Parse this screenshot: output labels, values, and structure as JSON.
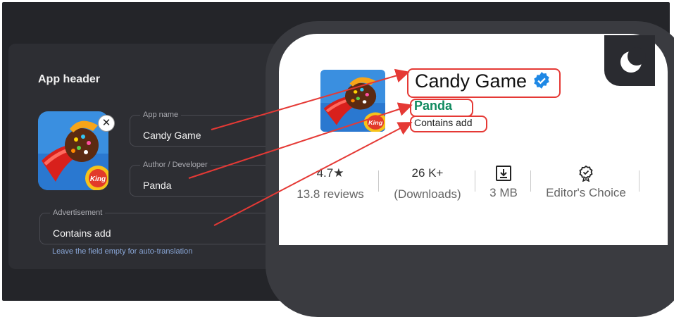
{
  "panel": {
    "title": "App header",
    "app_name_label": "App name",
    "app_name_value": "Candy Game",
    "author_label": "Author / Developer",
    "author_value": "Panda",
    "ad_label": "Advertisement",
    "ad_value": "Contains add",
    "hint": "Leave the field empty for auto-translation",
    "remove_icon": "close-icon"
  },
  "preview": {
    "title": "Candy Game",
    "verified_icon": "verified-badge-icon",
    "author": "Panda",
    "ad_text": "Contains add",
    "theme_icon": "moon-icon",
    "stats": [
      {
        "top": "4.7★",
        "bottom": "13.8 reviews"
      },
      {
        "top": "26 K+",
        "bottom": "(Downloads)"
      },
      {
        "icon": "download-icon",
        "bottom": "3 MB"
      },
      {
        "icon": "award-ribbon-icon",
        "bottom": "Editor's Choice"
      }
    ]
  },
  "colors": {
    "background": "#242529",
    "panel": "#2d2e33",
    "highlight": "#e53935",
    "author_green": "#0f8a5f",
    "verified_blue": "#1e88e5"
  }
}
